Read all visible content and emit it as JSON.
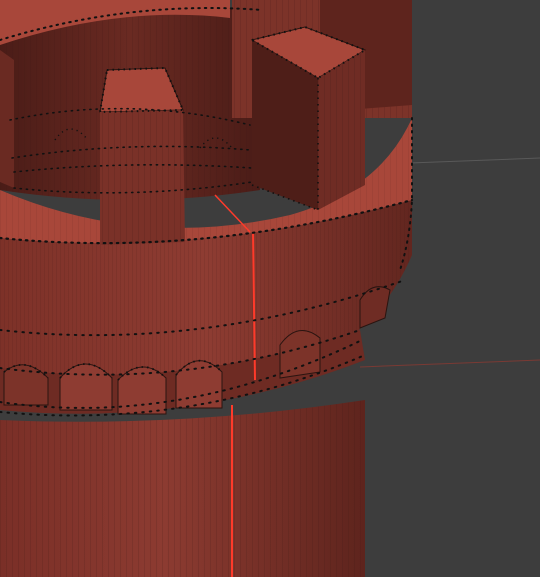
{
  "viewport": {
    "name": "3d-viewport",
    "background": "#3d3d3d",
    "mode": "edit-mode-wireframe-overlay"
  },
  "model": {
    "object": "castle-tower",
    "face_color": "#8a3a30",
    "face_dark": "#6a2a22",
    "face_light": "#a8473a",
    "edge_color": "#2a1410",
    "vertex_color": "#0d0d0d",
    "selected_edge_color": "#ff3a2a",
    "floor_grid_color": "#575757"
  }
}
